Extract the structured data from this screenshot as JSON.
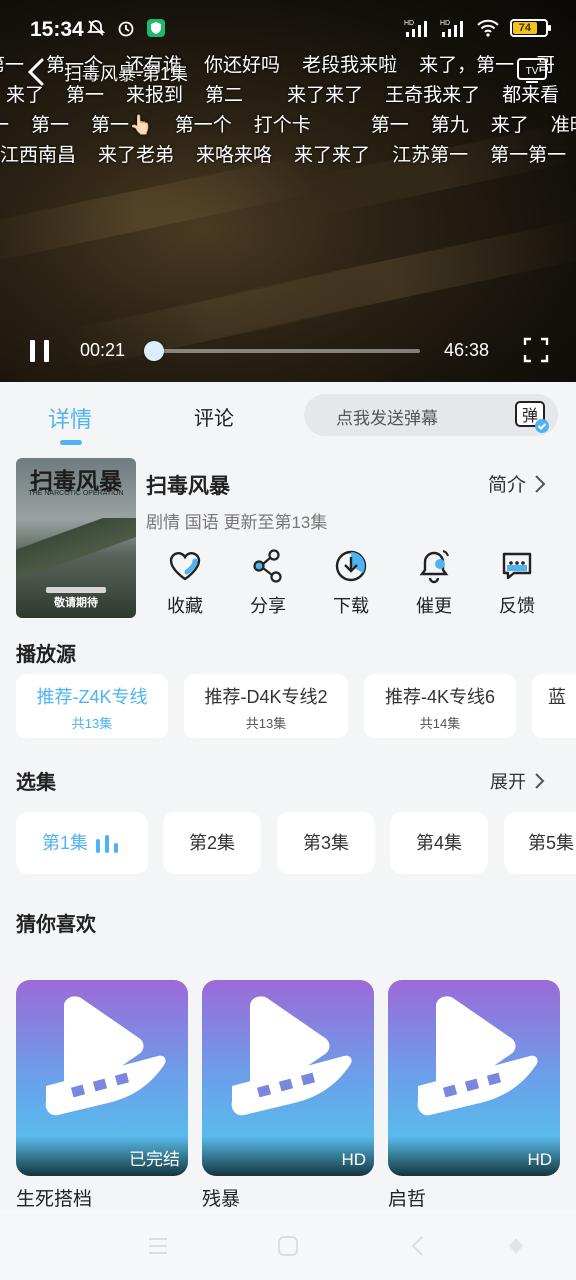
{
  "status_bar": {
    "time": "15:34",
    "battery": "74",
    "signal1": "HD",
    "signal2": "HD"
  },
  "player": {
    "title": "扫毒风暴-第1集",
    "current_time": "00:21",
    "total_time": "46:38",
    "progress_fraction": 0.0075,
    "tv_label": "TV",
    "danmaku": [
      [
        "第一",
        "第一个",
        "还有谁",
        "你还好吗",
        "老段我来啦",
        "来了，第一",
        "哥"
      ],
      [
        "来了",
        "第一",
        "来报到",
        "第二",
        "来了来了",
        "王奇我来了",
        "都来看"
      ],
      [
        "一",
        "第一",
        "第一👆🏻",
        "第一个",
        "打个卡",
        "第一",
        "第九",
        "来了",
        "准时"
      ],
      [
        "江西南昌",
        "来了老弟",
        "来咯来咯",
        "来了来了",
        "江苏第一",
        "第一第一"
      ]
    ]
  },
  "tabs": {
    "details": "详情",
    "comments": "评论",
    "danmu_placeholder": "点我发送弹幕",
    "danmu_icon_text": "弹"
  },
  "show": {
    "title": "扫毒风暴",
    "meta": "剧情 国语 更新至第13集",
    "intro": "简介",
    "poster": {
      "title": "扫毒风暴",
      "subtitle": "THE NARCOTIC OPERATION",
      "footer": "敬请期待"
    }
  },
  "actions": [
    {
      "label": "收藏",
      "icon": "heart-icon"
    },
    {
      "label": "分享",
      "icon": "share-icon"
    },
    {
      "label": "下载",
      "icon": "download-icon"
    },
    {
      "label": "催更",
      "icon": "bell-icon"
    },
    {
      "label": "反馈",
      "icon": "feedback-icon"
    }
  ],
  "sources_section": {
    "title": "播放源",
    "items": [
      {
        "name": "推荐-Z4K专线",
        "count": "共13集"
      },
      {
        "name": "推荐-D4K专线2",
        "count": "共13集"
      },
      {
        "name": "推荐-4K专线6",
        "count": "共14集"
      },
      {
        "name": "蓝",
        "count": ""
      }
    ]
  },
  "episodes_section": {
    "title": "选集",
    "expand": "展开",
    "items": [
      "第1集",
      "第2集",
      "第3集",
      "第4集",
      "第5集"
    ]
  },
  "recommend_section": {
    "title": "猜你喜欢",
    "items": [
      {
        "name": "生死搭档",
        "badge": "已完结"
      },
      {
        "name": "残暴",
        "badge": "HD"
      },
      {
        "name": "启哲",
        "badge": "HD"
      }
    ]
  },
  "colors": {
    "accent": "#4fb3f2",
    "background": "#f4f5f7"
  }
}
